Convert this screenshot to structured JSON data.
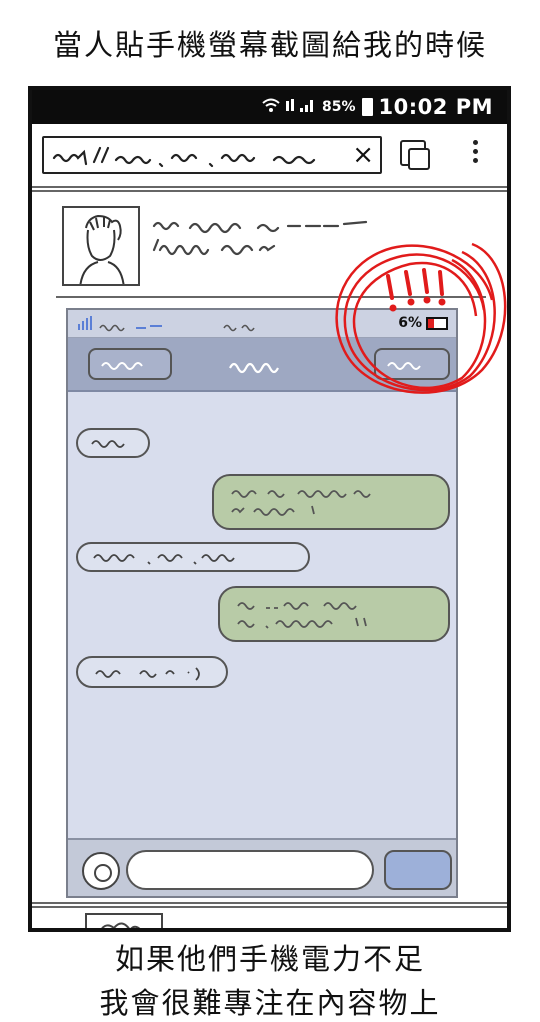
{
  "captions": {
    "top": "當人貼手機螢幕截圖給我的時候",
    "bottom_line1": "如果他們手機電力不足",
    "bottom_line2": "我會很難專注在內容物上"
  },
  "phone": {
    "status": {
      "battery": "85%",
      "time": "10:02 PM"
    },
    "url_clear": "×"
  },
  "screenshot": {
    "battery": "6%"
  },
  "colors": {
    "phone_bezel": "#111111",
    "status_bar": "#0c0c0c",
    "screenshot_bg": "#d8dded",
    "nav_bar": "#9ea8c2",
    "incoming_bubble": "#dde2ef",
    "outgoing_bubble": "#b8cba7",
    "send_button": "#9db0d9",
    "low_battery": "#e02020",
    "annotation": "#e11b1b"
  },
  "icons": [
    "wifi-icon",
    "signal-icon",
    "battery-icon",
    "tabs-icon",
    "menu-dots-icon",
    "camera-icon",
    "low-battery-icon"
  ]
}
